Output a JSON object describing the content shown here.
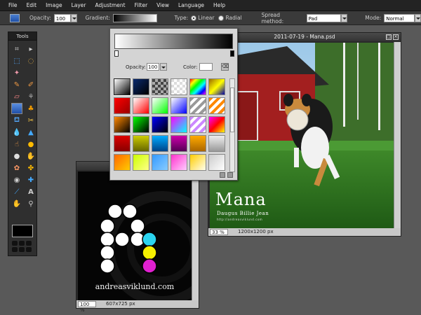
{
  "menu": [
    "File",
    "Edit",
    "Image",
    "Layer",
    "Adjustment",
    "Filter",
    "View",
    "Language",
    "Help"
  ],
  "options": {
    "opacity_label": "Opacity:",
    "opacity_value": "100",
    "gradient_label": "Gradient:",
    "type_label": "Type:",
    "linear_label": "Linear",
    "radial_label": "Radial",
    "spread_label": "Spread method:",
    "spread_value": "Pad",
    "mode_label": "Mode:",
    "mode_value": "Normal"
  },
  "tools_panel": {
    "title": "Tools"
  },
  "gradient_picker": {
    "opacity_label": "Opacity:",
    "opacity_value": "100",
    "color_label": "Color:",
    "swatches": [
      "linear-gradient(135deg,#fff,#000)",
      "linear-gradient(135deg,#0b2a6e,#000)",
      "repeating-conic-gradient(#aaa 0 25%,#444 0 50%) 0 0/8px 8px",
      "repeating-conic-gradient(#fff 0 25%,#ddd 0 50%) 0 0/8px 8px",
      "linear-gradient(135deg,#f00,#ff0,#0f0,#0ff,#00f,#f0f)",
      "linear-gradient(135deg,#9a6a00,#ff0,#00a)",
      "linear-gradient(135deg,#f00,#900)",
      "linear-gradient(135deg,#fff,#f00)",
      "linear-gradient(135deg,#fff,#0f0)",
      "linear-gradient(135deg,#fff,#00f)",
      "repeating-linear-gradient(135deg,#999 0 4px,#fff 4px 8px)",
      "repeating-linear-gradient(135deg,#f80 0 4px,#fff 4px 8px)",
      "linear-gradient(135deg,#f80,#000)",
      "linear-gradient(135deg,#0f0,#000)",
      "linear-gradient(135deg,#00f,#000)",
      "linear-gradient(135deg,#f0f,#0ff)",
      "repeating-linear-gradient(135deg,#c8f 0 4px,#fff 4px 8px)",
      "linear-gradient(135deg,#f0f,#f00,#ff0)",
      "linear-gradient(#d00,#800)",
      "linear-gradient(#cc0,#660)",
      "linear-gradient(#0af,#048)",
      "linear-gradient(#c0a,#505)",
      "linear-gradient(#fa0,#a60)",
      "linear-gradient(#eee,#999)",
      "linear-gradient(135deg,#f60,#fc0)",
      "linear-gradient(135deg,#cf0,#ff8)",
      "linear-gradient(135deg,#39f,#8cf)",
      "linear-gradient(135deg,#f3c,#fcf)",
      "linear-gradient(135deg,#fc0,#ffe)",
      "linear-gradient(135deg,#ccc,#fff)"
    ]
  },
  "mana_window": {
    "title": "2011-07-19 - Mana.psd",
    "zoom": "33",
    "zoom_unit": "%",
    "dims": "1200x1200 px",
    "image_title": "Mana",
    "image_subtitle": "Daugus Billie Jean",
    "image_url": "http://andreasviklund.com"
  },
  "andreas_window": {
    "zoom": "100",
    "zoom_unit": "%",
    "dims": "607x725 px",
    "image_text": "andreasviklund.com"
  }
}
